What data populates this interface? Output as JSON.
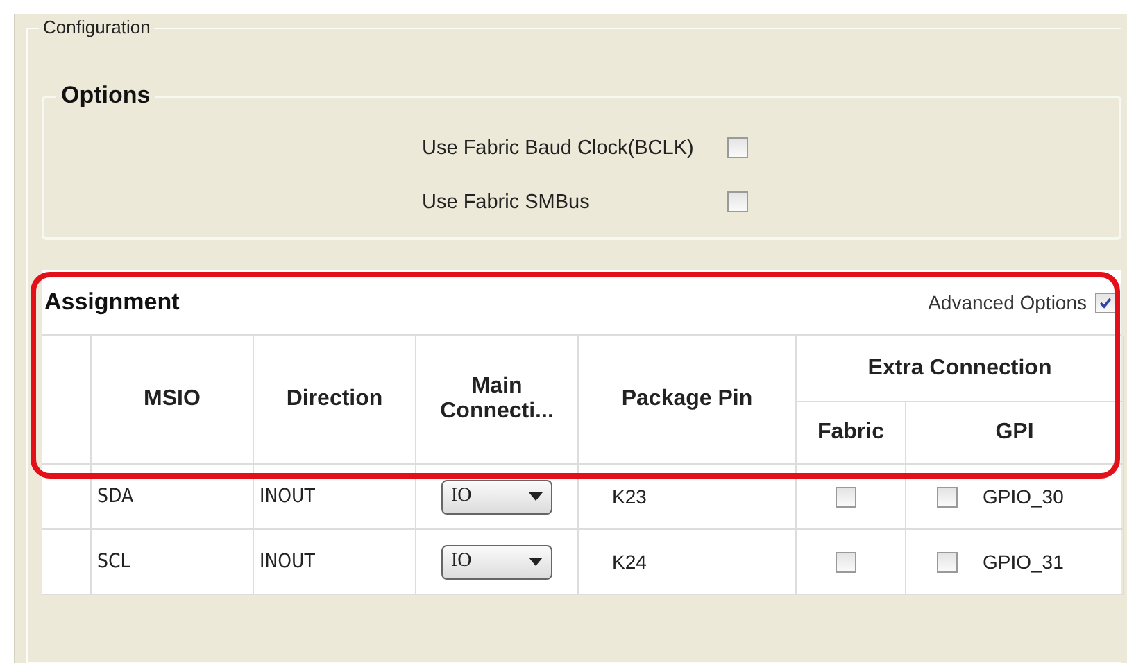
{
  "panel": {
    "title": "Configuration"
  },
  "options": {
    "title": "Options",
    "items": [
      {
        "label": "Use Fabric Baud Clock(BCLK)",
        "checked": false
      },
      {
        "label": "Use Fabric SMBus",
        "checked": false
      }
    ]
  },
  "assignment": {
    "title": "Assignment",
    "highlighted": true,
    "advanced_options": {
      "label": "Advanced Options",
      "checked": true
    },
    "columns": [
      "MSIO",
      "Direction",
      "Main Connecti...",
      "Package Pin"
    ],
    "group_header": "Extra Connection",
    "sub_columns": [
      "Fabric",
      "GPI"
    ],
    "rows": [
      {
        "msio": "SDA",
        "direction": "INOUT",
        "main_connection": "IO",
        "package_pin": "K23",
        "fabric": false,
        "gpi": false,
        "gpi_name": "GPIO_30"
      },
      {
        "msio": "SCL",
        "direction": "INOUT",
        "main_connection": "IO",
        "package_pin": "K24",
        "fabric": false,
        "gpi": false,
        "gpi_name": "GPIO_31"
      }
    ]
  }
}
